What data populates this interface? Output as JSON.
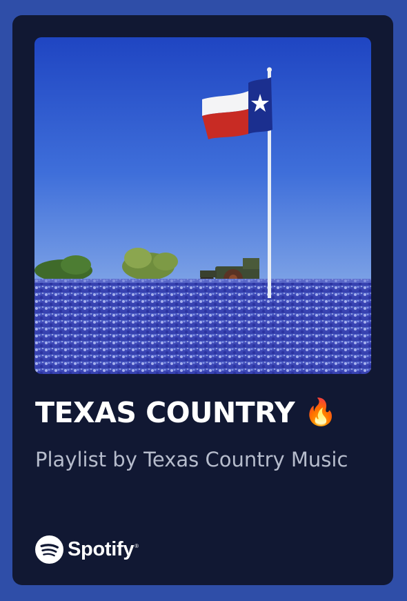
{
  "playlist": {
    "title": "TEXAS COUNTRY",
    "title_emoji": "🔥",
    "subtitle": "Playlist by Texas Country Music"
  },
  "brand": {
    "name": "Spotify",
    "registered_mark": "®",
    "logo_icon": "spotify-icon"
  },
  "cover_art": {
    "description_icon": "texas-flag-bluebonnet-field-image"
  },
  "colors": {
    "background": "#2f4ea8",
    "card": "#111833",
    "title": "#ffffff",
    "subtitle": "#b6bccc",
    "flame": "#ff7a1a"
  }
}
